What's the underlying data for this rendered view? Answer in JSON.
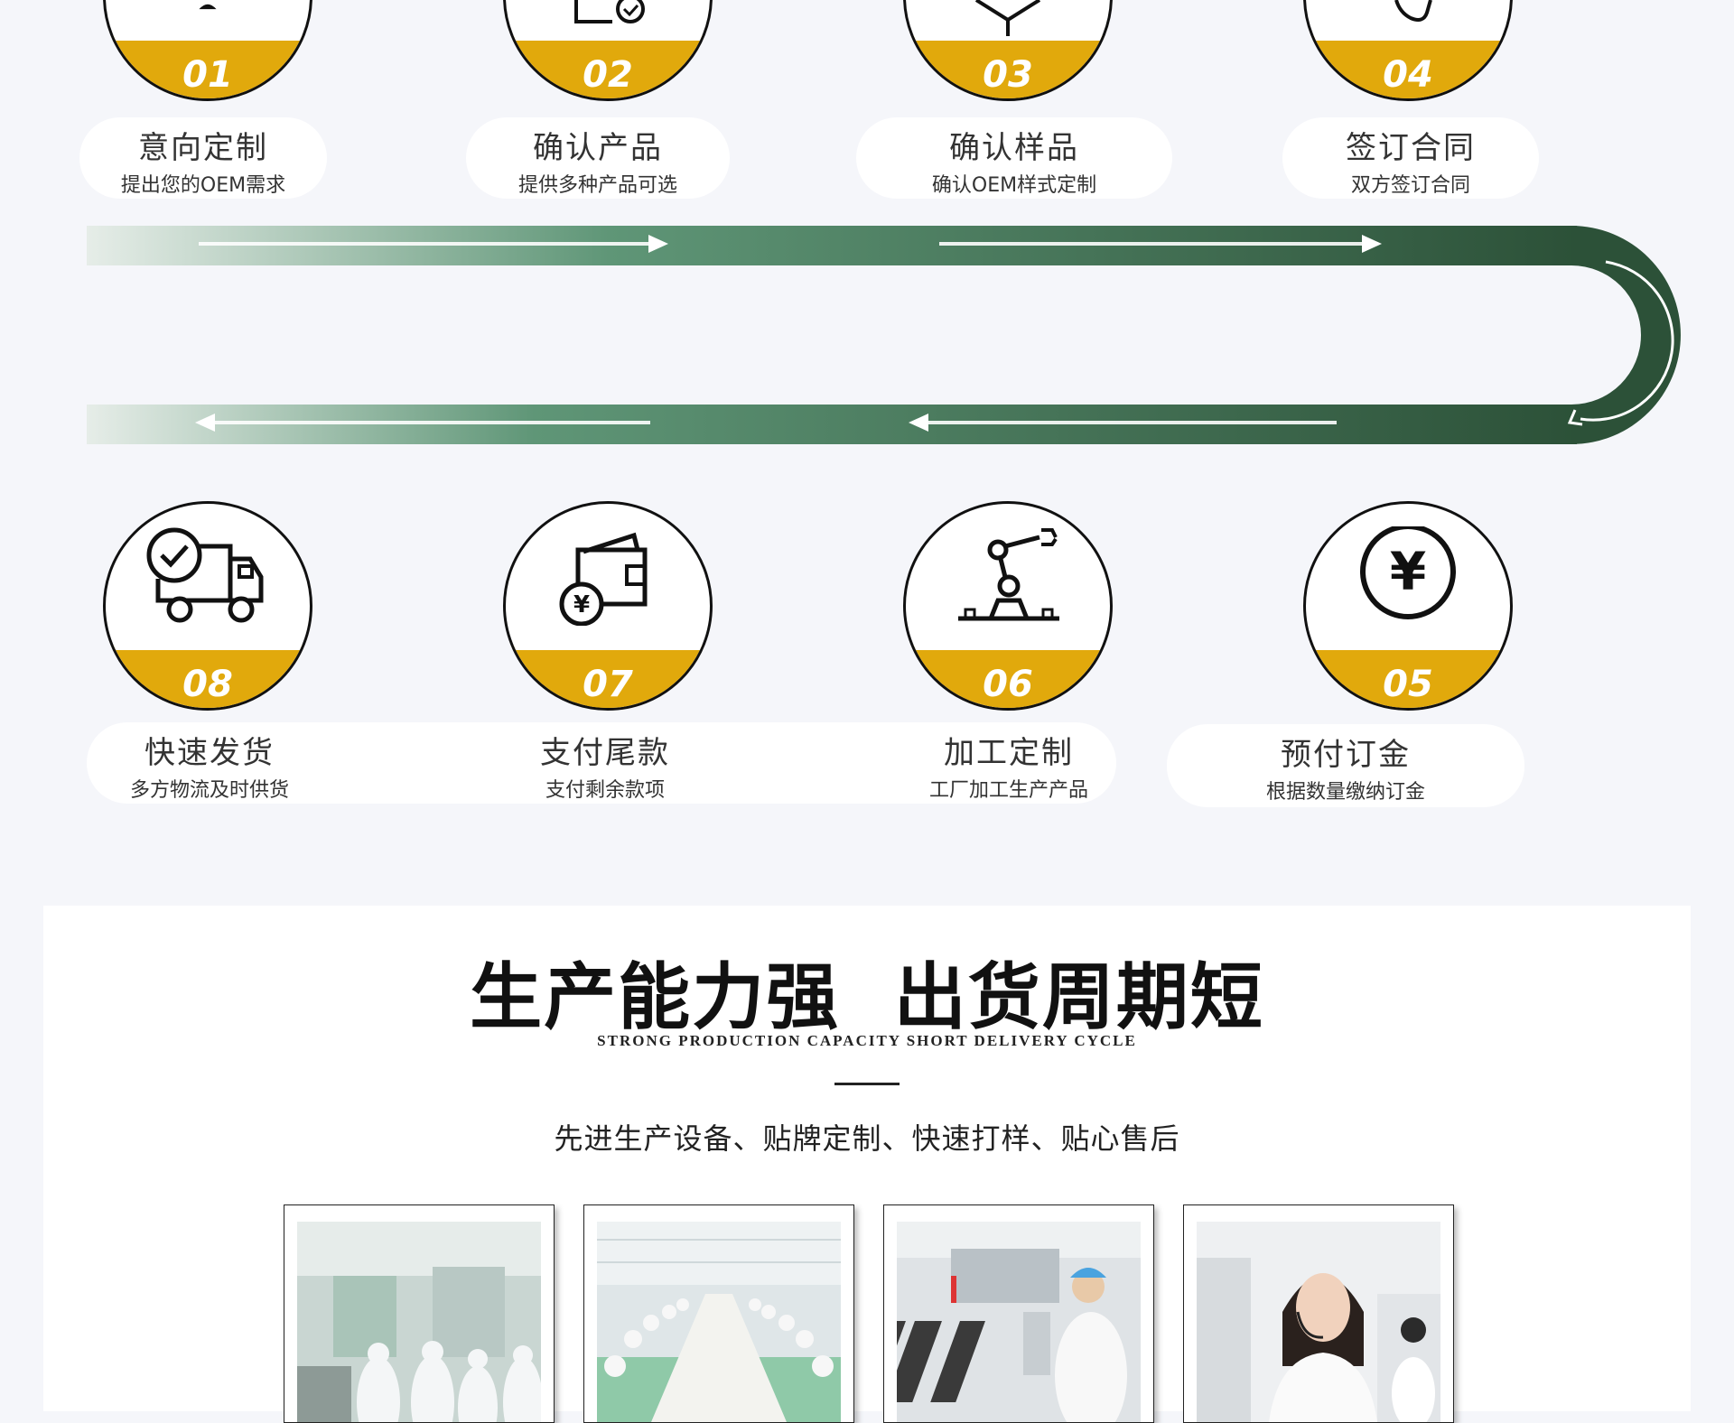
{
  "steps_top": [
    {
      "num": "01",
      "title": "意向定制",
      "subtitle": "提出您的OEM需求",
      "icon": "user-icon"
    },
    {
      "num": "02",
      "title": "确认产品",
      "subtitle": "提供多种产品可选",
      "icon": "document-check-icon"
    },
    {
      "num": "03",
      "title": "确认样品",
      "subtitle": "确认OEM样式定制",
      "icon": "box-icon"
    },
    {
      "num": "04",
      "title": "签订合同",
      "subtitle": "双方签订合同",
      "icon": "handshake-icon"
    }
  ],
  "steps_bottom": [
    {
      "num": "08",
      "title": "快速发货",
      "subtitle": "多方物流及时供货",
      "icon": "delivery-truck-icon"
    },
    {
      "num": "07",
      "title": "支付尾款",
      "subtitle": "支付剩余款项",
      "icon": "wallet-icon"
    },
    {
      "num": "06",
      "title": "加工定制",
      "subtitle": "工厂加工生产产品",
      "icon": "robot-arm-icon"
    },
    {
      "num": "05",
      "title": "预付订金",
      "subtitle": "根据数量缴纳订金",
      "icon": "yuan-icon"
    }
  ],
  "section": {
    "title": "生产能力强  出货周期短",
    "subtitle": "STRONG PRODUCTION CAPACITY SHORT DELIVERY CYCLE",
    "description": "先进生产设备、贴牌定制、快速打样、贴心售后"
  },
  "colors": {
    "accent": "#e1a90c",
    "track_dark": "#2f5a3f",
    "track_light": "#e8efe9"
  },
  "photos": [
    {
      "icon": "cleanroom-workers-photo"
    },
    {
      "icon": "production-line-photo"
    },
    {
      "icon": "lab-machine-photo"
    },
    {
      "icon": "customer-service-photo"
    }
  ]
}
